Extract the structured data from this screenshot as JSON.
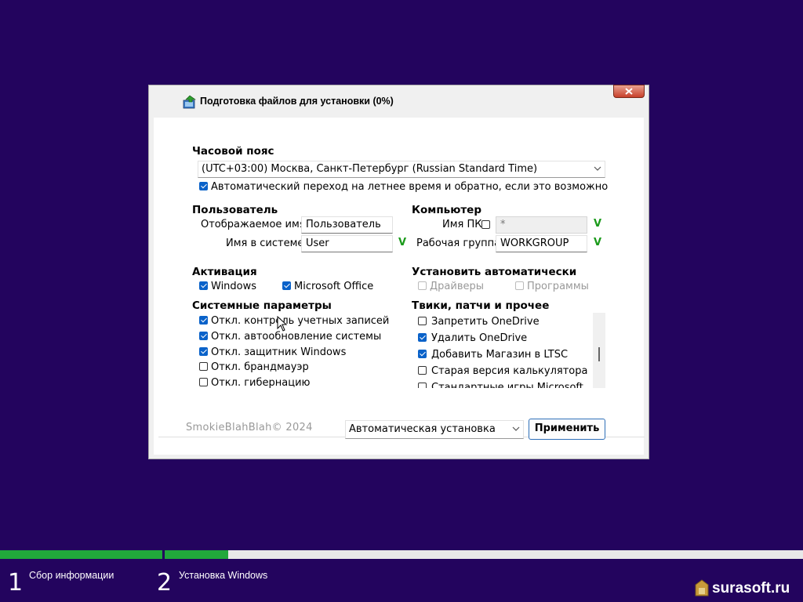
{
  "window": {
    "title": "Подготовка файлов для установки (0%)",
    "icon": "install-package-icon"
  },
  "timezone": {
    "section_label": "Часовой пояс",
    "selected": "(UTC+03:00) Москва, Санкт-Петербург (Russian Standard Time)",
    "dst_label": "Автоматический переход на летнее время и обратно, если это возможно",
    "dst_checked": true
  },
  "user": {
    "section_label": "Пользователь",
    "display_name_label": "Отображаемое имя",
    "display_name_value": "Пользователь",
    "login_label": "Имя в системе",
    "login_value": "User",
    "valid_mark": "V"
  },
  "computer": {
    "section_label": "Компьютер",
    "pc_name_label": "Имя ПК",
    "pc_name_checked": false,
    "pc_name_value": "*",
    "pc_valid_mark": "V",
    "workgroup_label": "Рабочая группа",
    "workgroup_value": "WORKGROUP",
    "wg_valid_mark": "V"
  },
  "activation": {
    "section_label": "Активация",
    "windows_label": "Windows",
    "windows_checked": true,
    "office_label": "Microsoft Office",
    "office_checked": true
  },
  "auto_install": {
    "section_label": "Установить автоматически",
    "drivers_label": "Драйверы",
    "programs_label": "Программы"
  },
  "system": {
    "section_label": "Системные параметры",
    "items": [
      {
        "label": "Откл. контроль учетных записей",
        "checked": true
      },
      {
        "label": "Откл. автообновление системы",
        "checked": true
      },
      {
        "label": "Откл. защитник Windows",
        "checked": true
      },
      {
        "label": "Откл. брандмауэр",
        "checked": false
      },
      {
        "label": "Откл. гибернацию",
        "checked": false
      }
    ]
  },
  "tweaks": {
    "section_label": "Твики, патчи и прочее",
    "items": [
      {
        "label": "Запретить OneDrive",
        "checked": false
      },
      {
        "label": "Удалить OneDrive",
        "checked": true
      },
      {
        "label": "Добавить Магазин в LTSC",
        "checked": true
      },
      {
        "label": "Старая версия калькулятора",
        "checked": false
      },
      {
        "label": "Стандартные игры Microsoft",
        "checked": false
      }
    ]
  },
  "footer": {
    "brand": "SmokieBlahBlah© 2024",
    "mode_selected": "Автоматическая установка",
    "apply_label": "Применить"
  },
  "progress": {
    "step1_fraction": 1.0,
    "step2_fraction": 0.1
  },
  "steps": [
    {
      "number": "1",
      "label": "Сбор информации"
    },
    {
      "number": "2",
      "label": "Установка Windows"
    }
  ],
  "watermark": "surasoft.ru",
  "colors": {
    "background": "#23045e",
    "progress": "#21a83b",
    "accent": "#0a62c9",
    "valid": "#1a9a1a"
  }
}
